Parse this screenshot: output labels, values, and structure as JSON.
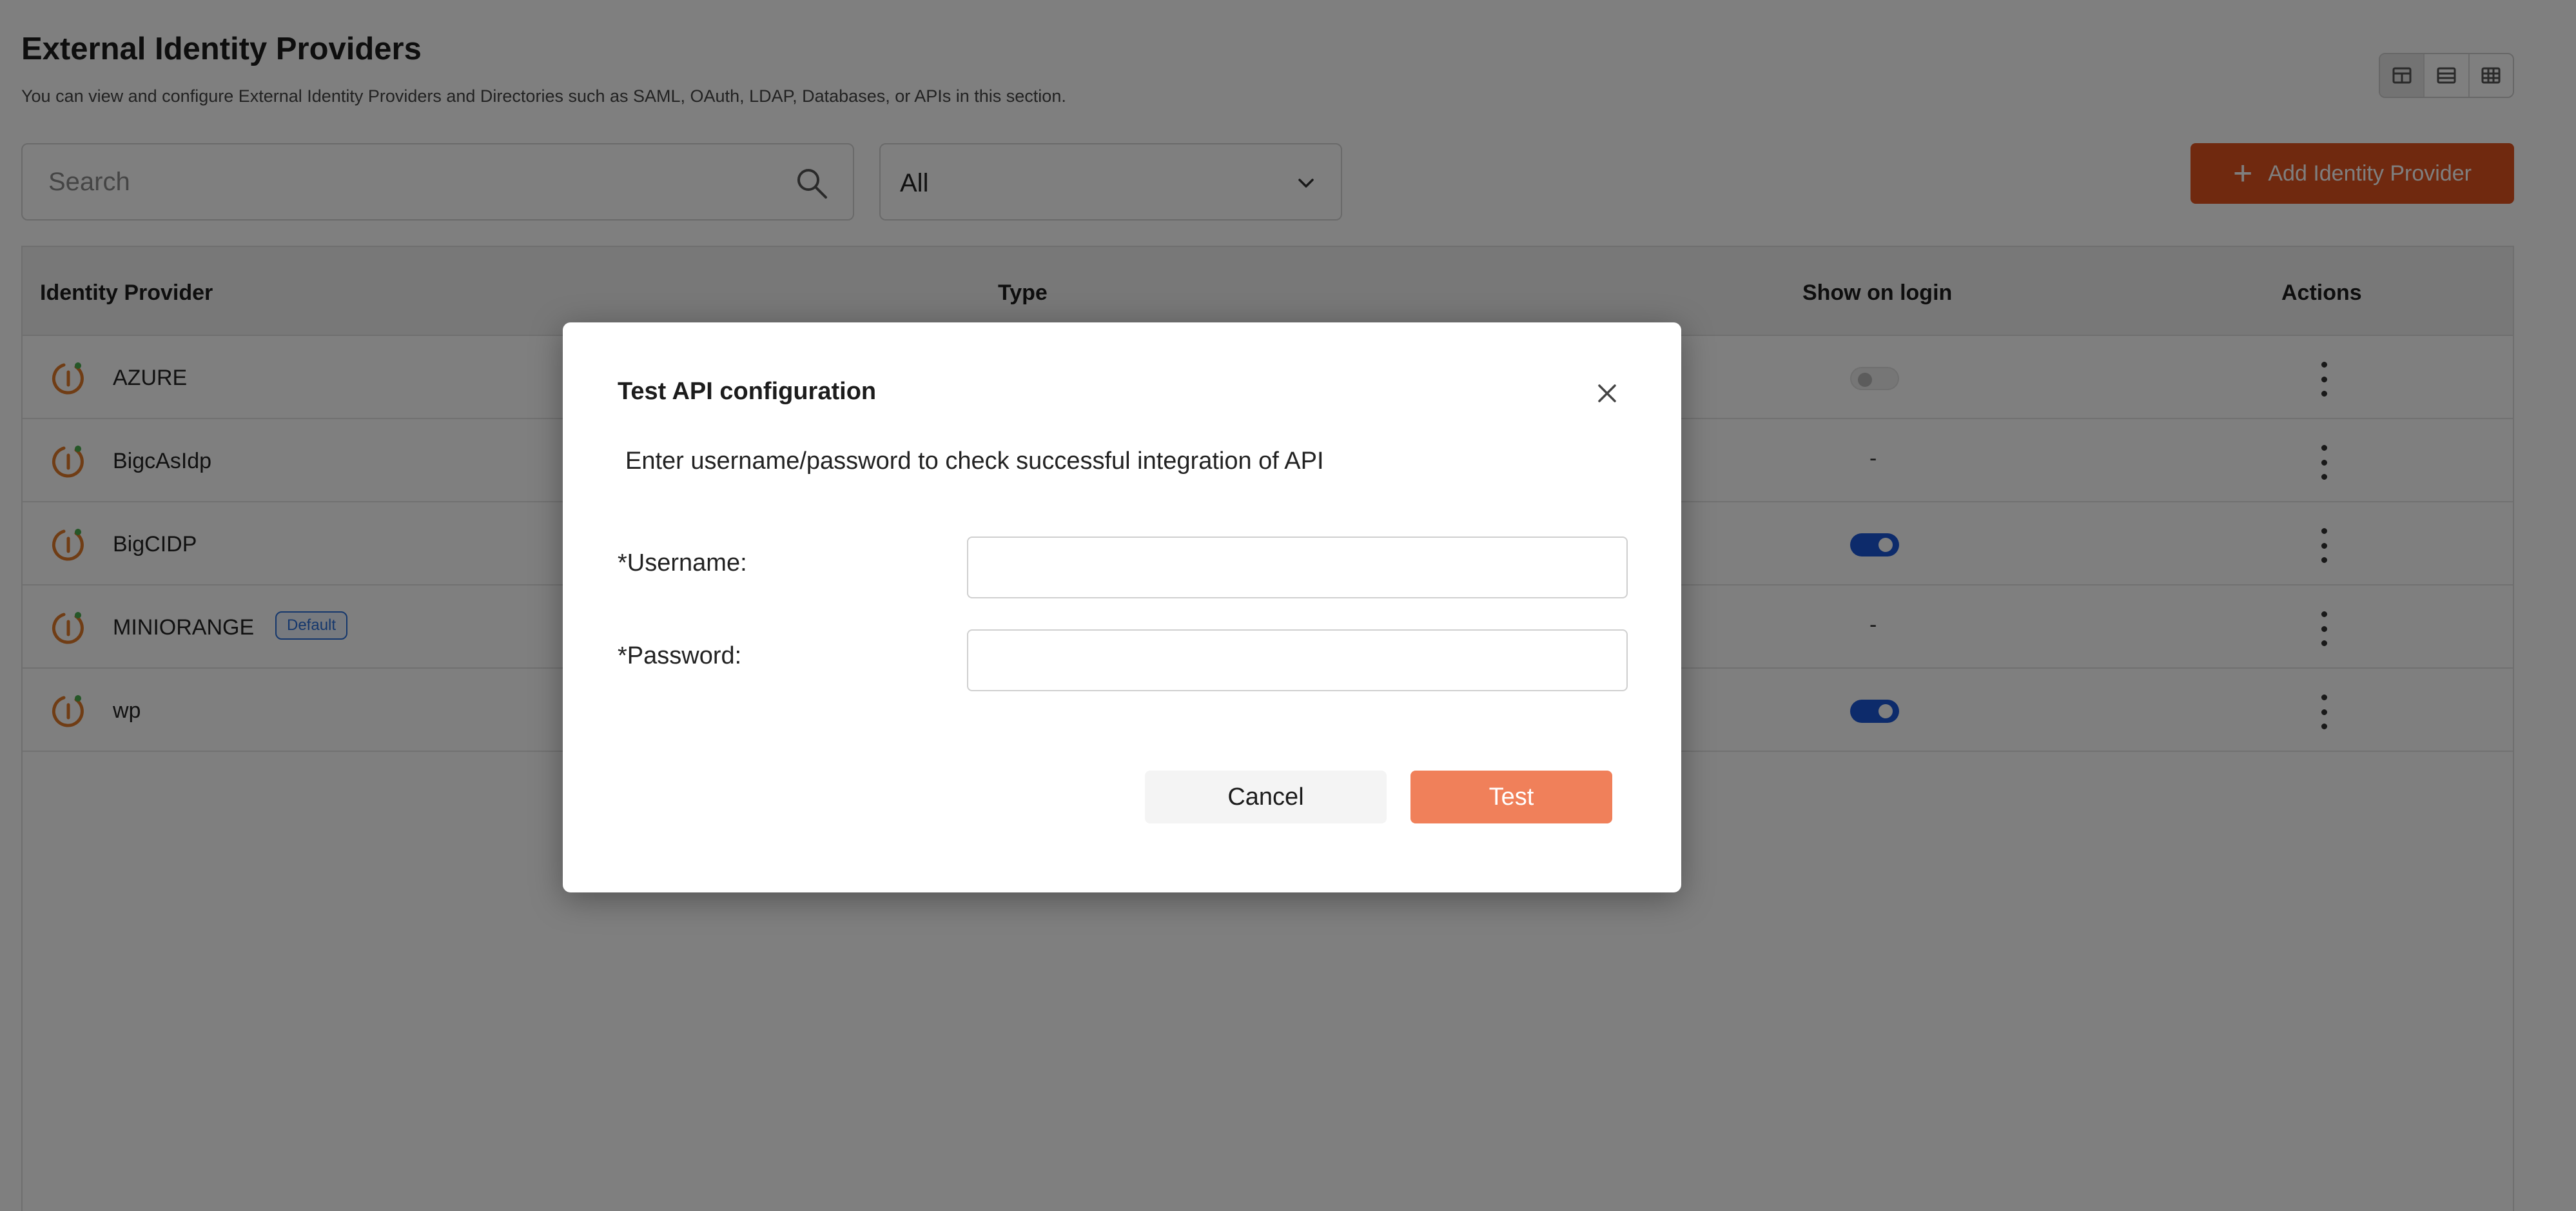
{
  "header": {
    "title": "External Identity Providers",
    "subtitle": "You can view and configure External Identity Providers and Directories such as SAML, OAuth, LDAP, Databases, or APIs in this section."
  },
  "search": {
    "placeholder": "Search",
    "value": ""
  },
  "filter": {
    "selected": "All"
  },
  "add_button": {
    "label": "Add Identity Provider"
  },
  "table": {
    "columns": [
      "Identity Provider",
      "Type",
      "Show on login",
      "Actions"
    ],
    "rows": [
      {
        "name": "AZURE",
        "badge": "",
        "show_on_login": "off",
        "show_text": ""
      },
      {
        "name": "BigcAsIdp",
        "badge": "",
        "show_on_login": "none",
        "show_text": "-"
      },
      {
        "name": "BigCIDP",
        "badge": "",
        "show_on_login": "on",
        "show_text": ""
      },
      {
        "name": "MINIORANGE",
        "badge": "Default",
        "show_on_login": "none",
        "show_text": "-"
      },
      {
        "name": "wp",
        "badge": "",
        "show_on_login": "on",
        "show_text": ""
      }
    ]
  },
  "modal": {
    "title": "Test API configuration",
    "description": "Enter username/password to check successful integration of API",
    "username_label": "*Username:",
    "username_value": "",
    "password_label": "*Password:",
    "password_value": "",
    "cancel_label": "Cancel",
    "test_label": "Test"
  },
  "colors": {
    "accent": "#e0531f",
    "test_button": "#f0805a",
    "toggle_on": "#1a56d6",
    "badge": "#2a6fd8",
    "logo": "#e07a2a"
  }
}
